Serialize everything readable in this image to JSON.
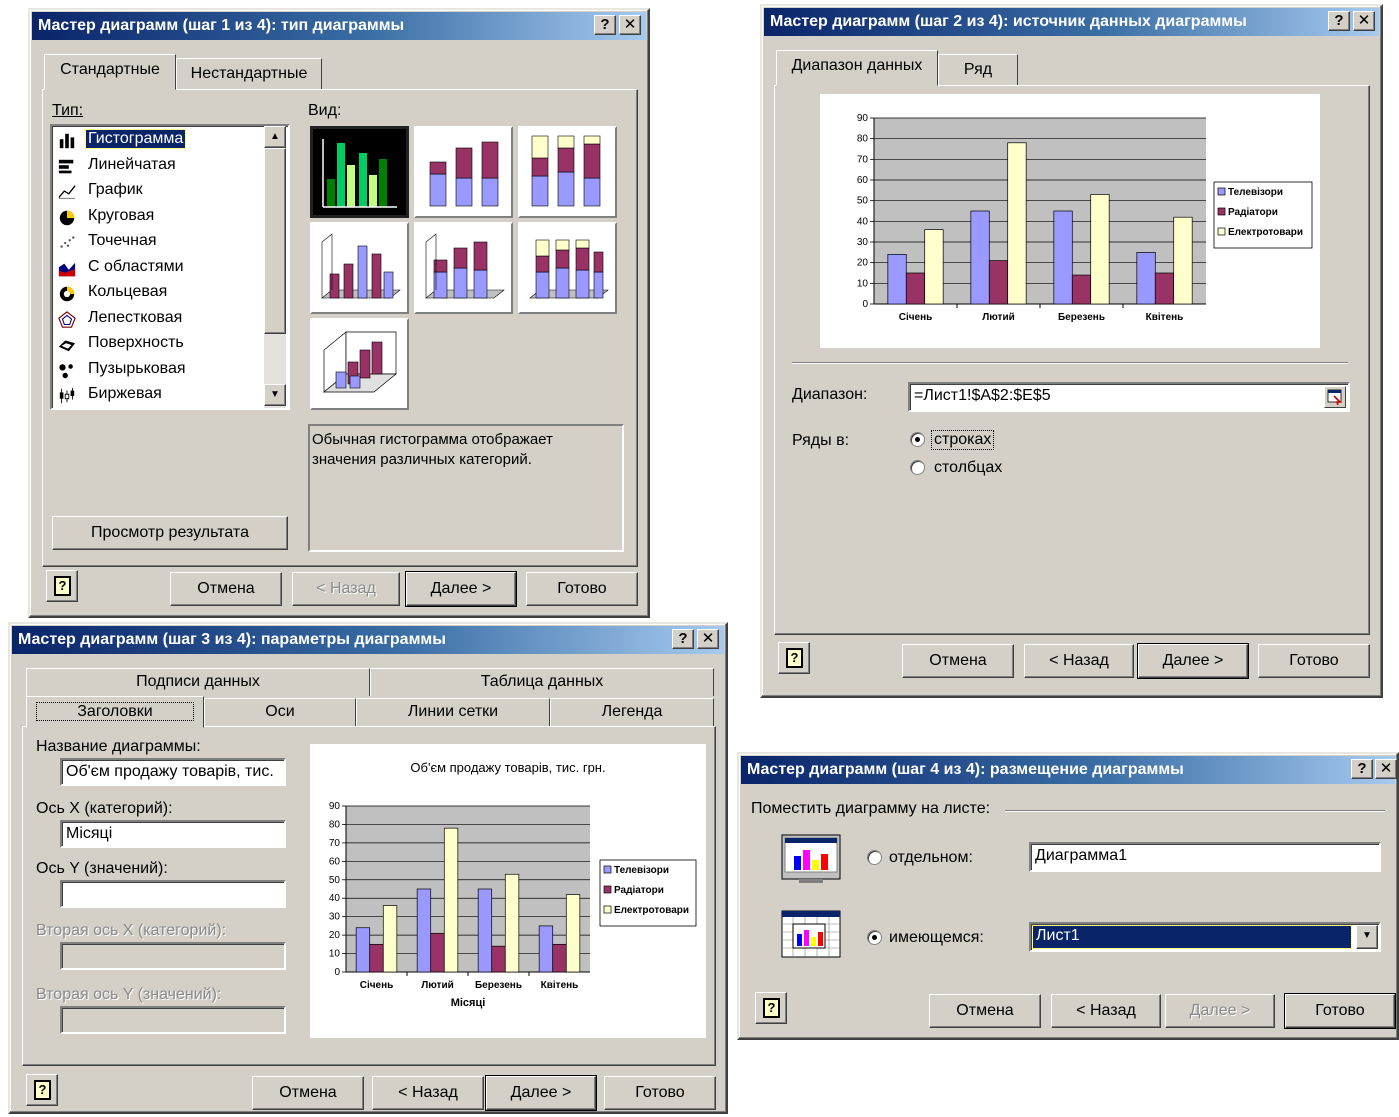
{
  "colors": {
    "series1": "#9999ff",
    "series2": "#993366",
    "series3": "#ffffcc",
    "title_dark": "#0a246a"
  },
  "step1": {
    "title": "Мастер диаграмм (шаг 1 из 4): тип диаграммы",
    "tabs": [
      "Стандартные",
      "Нестандартные"
    ],
    "type_label": "Тип:",
    "view_label": "Вид:",
    "types": [
      {
        "label": "Гистограмма",
        "icon": "column-chart-icon"
      },
      {
        "label": "Линейчатая",
        "icon": "bar-chart-icon"
      },
      {
        "label": "График",
        "icon": "line-chart-icon"
      },
      {
        "label": "Круговая",
        "icon": "pie-chart-icon"
      },
      {
        "label": "Точечная",
        "icon": "scatter-chart-icon"
      },
      {
        "label": "С областями",
        "icon": "area-chart-icon"
      },
      {
        "label": "Кольцевая",
        "icon": "doughnut-chart-icon"
      },
      {
        "label": "Лепестковая",
        "icon": "radar-chart-icon"
      },
      {
        "label": "Поверхность",
        "icon": "surface-chart-icon"
      },
      {
        "label": "Пузырьковая",
        "icon": "bubble-chart-icon"
      },
      {
        "label": "Биржевая",
        "icon": "stock-chart-icon"
      }
    ],
    "description": "Обычная гистограмма отображает значения различных категорий.",
    "preview_button": "Просмотр результата",
    "buttons": {
      "cancel": "Отмена",
      "back": "< Назад",
      "next": "Далее >",
      "finish": "Готово"
    }
  },
  "step2": {
    "title": "Мастер диаграмм (шаг 2 из 4): источник данных диаграммы",
    "tabs": [
      "Диапазон данных",
      "Ряд"
    ],
    "range_label": "Диапазон:",
    "range_value": "=Лист1!$A$2:$E$5",
    "series_in_label": "Ряды в:",
    "option_rows": "строках",
    "option_cols": "столбцах",
    "buttons": {
      "cancel": "Отмена",
      "back": "< Назад",
      "next": "Далее >",
      "finish": "Готово"
    }
  },
  "step3": {
    "title": "Мастер диаграмм (шаг 3 из 4): параметры диаграммы",
    "tabs_back": [
      "Подписи данных",
      "Таблица данных"
    ],
    "tabs_front": [
      "Заголовки",
      "Оси",
      "Линии сетки",
      "Легенда"
    ],
    "chart_title_label": "Название диаграммы:",
    "chart_title_value": "Об'єм продажу товарів, тис.",
    "x_axis_label": "Ось X (категорий):",
    "x_axis_value": "Місяці",
    "y_axis_label": "Ось Y (значений):",
    "y_axis_value": "",
    "x2_axis_label": "Вторая ось X (категорий):",
    "y2_axis_label": "Вторая ось Y (значений):",
    "buttons": {
      "cancel": "Отмена",
      "back": "< Назад",
      "next": "Далее >",
      "finish": "Готово"
    }
  },
  "step4": {
    "title": "Мастер диаграмм (шаг 4 из 4): размещение диаграммы",
    "place_label": "Поместить диаграмму на листе:",
    "option_separate": "отдельном:",
    "separate_value": "Диаграмма1",
    "option_existing": "имеющемся:",
    "existing_value": "Лист1",
    "buttons": {
      "cancel": "Отмена",
      "back": "< Назад",
      "next": "Далее >",
      "finish": "Готово"
    }
  },
  "chart_data": [
    {
      "type": "bar",
      "title": "",
      "categories": [
        "Січень",
        "Лютий",
        "Березень",
        "Квітень"
      ],
      "series": [
        {
          "name": "Телевізори",
          "values": [
            24,
            45,
            45,
            25
          ]
        },
        {
          "name": "Радіатори",
          "values": [
            15,
            21,
            14,
            15
          ]
        },
        {
          "name": "Електротовари",
          "values": [
            36,
            78,
            53,
            42
          ]
        }
      ],
      "xlabel": "",
      "ylabel": "",
      "ylim": [
        0,
        90
      ],
      "yticks": [
        0,
        10,
        20,
        30,
        40,
        50,
        60,
        70,
        80,
        90
      ],
      "grid": true,
      "legend": "right"
    },
    {
      "type": "bar",
      "title": "Об'єм продажу товарів, тис. грн.",
      "categories": [
        "Січень",
        "Лютий",
        "Березень",
        "Квітень"
      ],
      "series": [
        {
          "name": "Телевізори",
          "values": [
            24,
            45,
            45,
            25
          ]
        },
        {
          "name": "Радіатори",
          "values": [
            15,
            21,
            14,
            15
          ]
        },
        {
          "name": "Електротовари",
          "values": [
            36,
            78,
            53,
            42
          ]
        }
      ],
      "xlabel": "Місяці",
      "ylabel": "",
      "ylim": [
        0,
        90
      ],
      "yticks": [
        0,
        10,
        20,
        30,
        40,
        50,
        60,
        70,
        80,
        90
      ],
      "grid": true,
      "legend": "right"
    }
  ]
}
